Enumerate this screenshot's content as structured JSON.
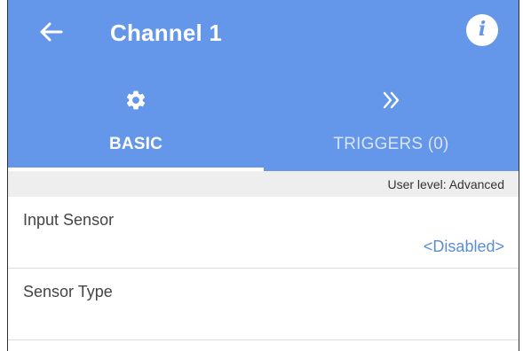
{
  "header": {
    "back_icon": "arrow-left-icon",
    "title": "Channel 1",
    "info_icon": "info-icon",
    "background_color": "#6496ea"
  },
  "tabs": [
    {
      "label": "BASIC",
      "icon": "gear-icon",
      "selected": true
    },
    {
      "label": "TRIGGERS (0)",
      "icon": "double-chevron-right-icon",
      "selected": false
    }
  ],
  "user_level": "User level: Advanced",
  "settings": [
    {
      "label": "Input Sensor",
      "value": "<Disabled>"
    },
    {
      "label": "Sensor Type",
      "value": ""
    }
  ],
  "colors": {
    "accent": "#6496ea",
    "value_text": "#5b8ed1",
    "level_bar": "#eeeeee"
  }
}
